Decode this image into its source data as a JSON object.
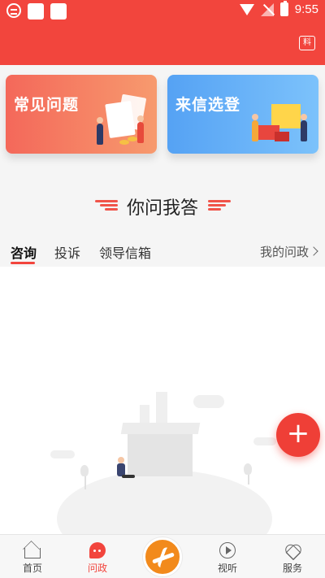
{
  "status_bar": {
    "time": "9:55"
  },
  "header": {
    "report_icon_text": "料"
  },
  "cards": [
    {
      "title": "常见问题",
      "icon": "faq-illustration"
    },
    {
      "title": "来信选登",
      "icon": "letter-illustration"
    }
  ],
  "section": {
    "title": "你问我答"
  },
  "tabs": {
    "items": [
      "咨询",
      "投诉",
      "领导信箱"
    ],
    "active_index": 0,
    "my_link": "我的问政"
  },
  "fab": {
    "label": "+"
  },
  "bottom_nav": {
    "items": [
      {
        "label": "首页",
        "icon": "home-icon"
      },
      {
        "label": "问政",
        "icon": "wenzheng-icon"
      },
      {
        "label": "",
        "icon": "center-logo"
      },
      {
        "label": "视听",
        "icon": "play-icon"
      },
      {
        "label": "服务",
        "icon": "heart-icon"
      }
    ],
    "active_index": 1
  },
  "colors": {
    "brand_red": "#f2453d",
    "faq_card": "#f4685a",
    "letter_card": "#55a2f4",
    "logo_orange": "#f28a1c"
  }
}
